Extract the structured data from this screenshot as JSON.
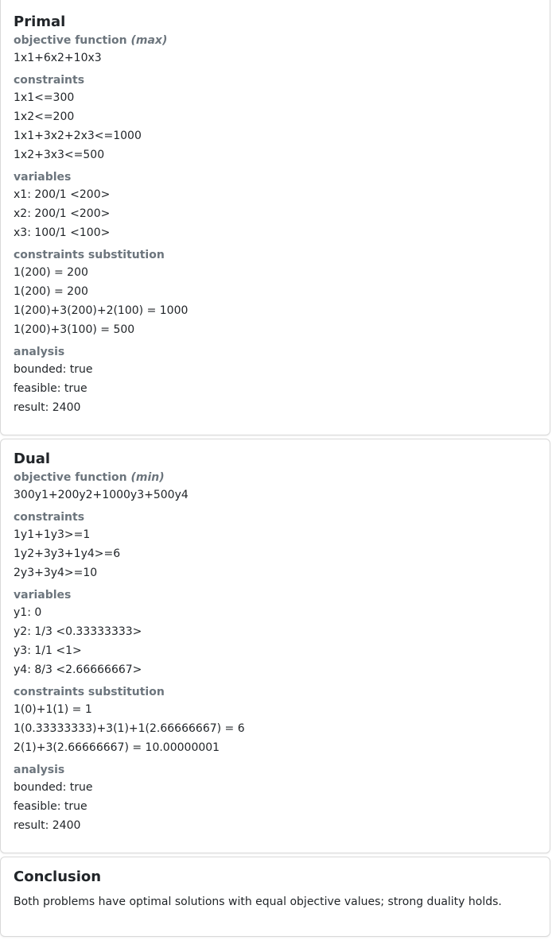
{
  "primal": {
    "title": "Primal",
    "objective_label": "objective function",
    "objective_sense": "(max)",
    "objective": "1x1+6x2+10x3",
    "constraints_label": "constraints",
    "constraints": [
      "1x1<=300",
      "1x2<=200",
      "1x1+3x2+2x3<=1000",
      "1x2+3x3<=500"
    ],
    "variables_label": "variables",
    "variables": [
      "x1: 200/1 <200>",
      "x2: 200/1 <200>",
      "x3: 100/1 <100>"
    ],
    "substitution_label": "constraints substitution",
    "substitution": [
      "1(200) = 200",
      "1(200) = 200",
      "1(200)+3(200)+2(100) = 1000",
      "1(200)+3(100) = 500"
    ],
    "analysis_label": "analysis",
    "analysis": [
      "bounded: true",
      "feasible: true",
      "result: 2400"
    ]
  },
  "dual": {
    "title": "Dual",
    "objective_label": "objective function",
    "objective_sense": "(min)",
    "objective": "300y1+200y2+1000y3+500y4",
    "constraints_label": "constraints",
    "constraints": [
      "1y1+1y3>=1",
      "1y2+3y3+1y4>=6",
      "2y3+3y4>=10"
    ],
    "variables_label": "variables",
    "variables": [
      "y1: 0",
      "y2: 1/3 <0.33333333>",
      "y3: 1/1 <1>",
      "y4: 8/3 <2.66666667>"
    ],
    "substitution_label": "constraints substitution",
    "substitution": [
      "1(0)+1(1) = 1",
      "1(0.33333333)+3(1)+1(2.66666667) = 6",
      "2(1)+3(2.66666667) = 10.00000001"
    ],
    "analysis_label": "analysis",
    "analysis": [
      "bounded: true",
      "feasible: true",
      "result: 2400"
    ]
  },
  "conclusion": {
    "title": "Conclusion",
    "text": "Both problems have optimal solutions with equal objective values; strong duality holds."
  }
}
